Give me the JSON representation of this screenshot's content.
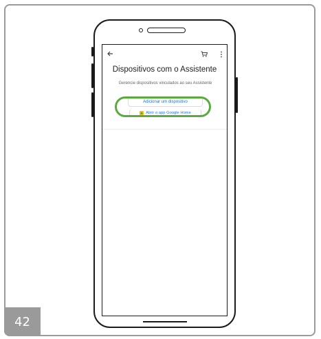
{
  "page_number": "42",
  "screen": {
    "title": "Dispositivos com o Assistente",
    "subtitle": "Gerencie dispositivos vinculados ao seu Assistente",
    "add_device_label": "Adicionar um dispositivo",
    "open_home_label": "Abrir o app Google Home"
  },
  "icons": {
    "back": "back-arrow-icon",
    "cart": "cart-icon",
    "more": "more-vert-icon",
    "home_app": "google-home-app-icon"
  },
  "colors": {
    "highlight": "#5aab3e",
    "link": "#1a73e8",
    "badge": "#9a9a9a"
  }
}
